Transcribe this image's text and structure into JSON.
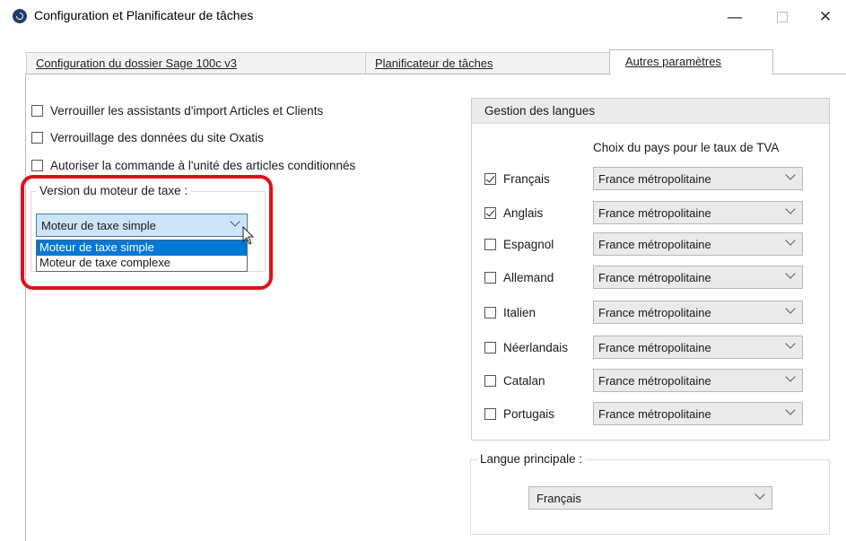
{
  "window": {
    "title": "Configuration et Planificateur de tâches",
    "minimize": "—",
    "close": "✕"
  },
  "tabs": [
    {
      "label": "Configuration du dossier Sage 100c v3",
      "active": false
    },
    {
      "label": "Planificateur de tâches",
      "active": false
    },
    {
      "label": "Autres paramètres",
      "active": true
    }
  ],
  "options": [
    {
      "label": "Verrouiller les assistants d'import Articles et Clients",
      "checked": false
    },
    {
      "label": "Verrouillage des données du site Oxatis",
      "checked": false
    },
    {
      "label": "Autoriser la commande à l'unité des articles conditionnés",
      "checked": false
    }
  ],
  "tax_engine": {
    "legend": "Version du moteur de taxe :",
    "selected": "Moteur de taxe simple",
    "dropdown_options": [
      "Moteur de taxe simple",
      "Moteur de taxe complexe"
    ],
    "highlighted_index": 0
  },
  "languages": {
    "header": "Gestion des langues",
    "vat_column_label": "Choix du pays pour le taux de TVA",
    "items": [
      {
        "name": "Français",
        "checked": true,
        "country": "France métropolitaine"
      },
      {
        "name": "Anglais",
        "checked": true,
        "country": "France métropolitaine"
      },
      {
        "name": "Espagnol",
        "checked": false,
        "country": "France métropolitaine"
      },
      {
        "name": "Allemand",
        "checked": false,
        "country": "France métropolitaine"
      },
      {
        "name": "Italien",
        "checked": false,
        "country": "France métropolitaine"
      },
      {
        "name": "Néerlandais",
        "checked": false,
        "country": "France métropolitaine"
      },
      {
        "name": "Catalan",
        "checked": false,
        "country": "France métropolitaine"
      },
      {
        "name": "Portugais",
        "checked": false,
        "country": "France métropolitaine"
      }
    ]
  },
  "main_language": {
    "legend": "Langue principale :",
    "selected": "Français"
  },
  "colors": {
    "highlight_outline": "#e0101a",
    "selection": "#0078d7"
  }
}
